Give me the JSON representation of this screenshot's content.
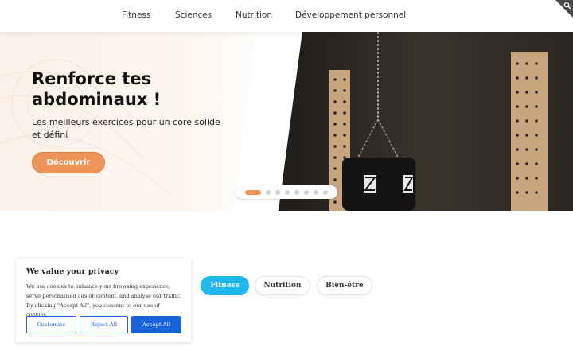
{
  "nav": {
    "items": [
      {
        "label": "Fitness"
      },
      {
        "label": "Sciences"
      },
      {
        "label": "Nutrition"
      },
      {
        "label": "Développement personnel"
      }
    ],
    "search_icon": "search-icon"
  },
  "hero": {
    "title": "Renforce tes\nabdominaux !",
    "subtitle": "Les meilleurs exercices pour un core solide et défini",
    "cta_label": "Découvrir",
    "slides_count": 8,
    "active_slide": 1
  },
  "categories": [
    {
      "label": "Fitness",
      "active": true
    },
    {
      "label": "Nutrition",
      "active": false
    },
    {
      "label": "Bien-être",
      "active": false
    }
  ],
  "cookie": {
    "title": "We value your privacy",
    "text": "We use cookies to enhance your browsing experience, serve personalised ads or content, and analyse our traffic. By clicking \"Accept All\", you consent to our use of cookies.",
    "customise_label": "Customise",
    "reject_label": "Reject All",
    "accept_label": "Accept All"
  },
  "colors": {
    "accent_orange": "#f0955a",
    "pill_active": "#1cb8ee",
    "cookie_blue": "#1863dc"
  }
}
